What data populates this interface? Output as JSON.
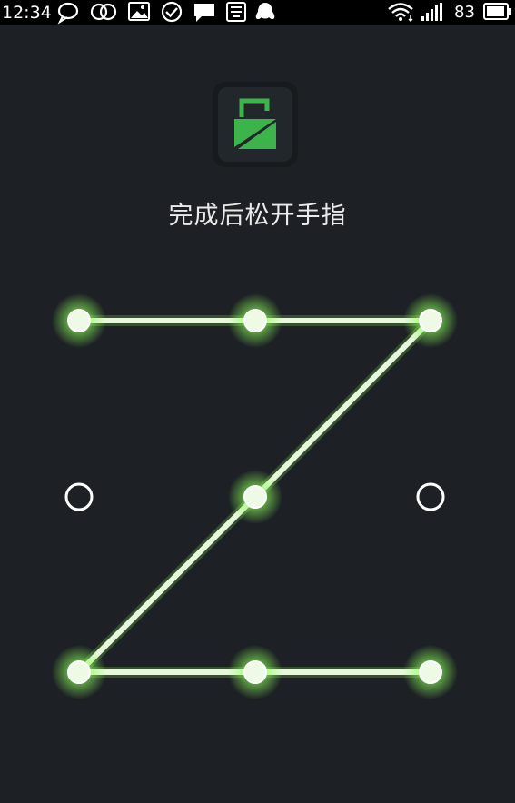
{
  "status_bar": {
    "time": "12:34",
    "battery_level": "83",
    "icons": [
      "chat-bubble-icon",
      "infinity-icon",
      "image-icon",
      "check-circle-icon",
      "message-icon",
      "app-icon",
      "qq-penguin-icon",
      "wifi-icon",
      "signal-icon",
      "battery-icon"
    ]
  },
  "app": {
    "icon": "lock-icon",
    "accent_color": "#3cb44b"
  },
  "prompt": {
    "text": "完成后松开手指"
  },
  "pattern_lock": {
    "grid": "3x3",
    "selected_dots": [
      1,
      2,
      3,
      5,
      7,
      8,
      9
    ],
    "path_order": [
      1,
      2,
      3,
      5,
      7,
      8,
      9
    ],
    "line_color": "#e8f6dc",
    "glow_color": "#8cff5a"
  }
}
